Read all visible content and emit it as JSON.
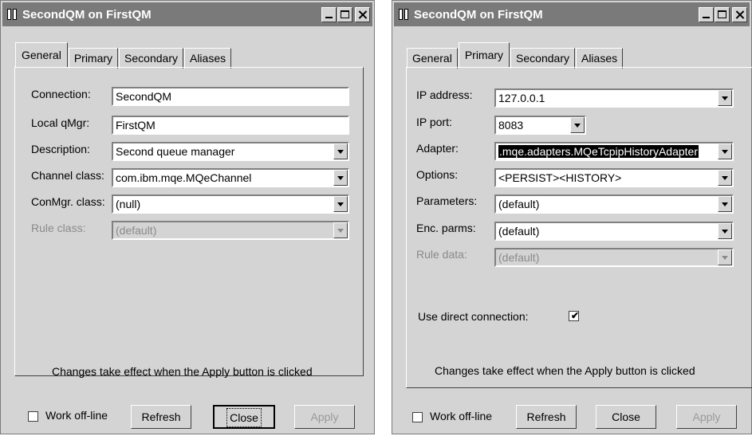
{
  "window_title": "SecondQM on FirstQM",
  "tabs": [
    "General",
    "Primary",
    "Secondary",
    "Aliases"
  ],
  "general": {
    "connection": {
      "label": "Connection:",
      "value": "SecondQM"
    },
    "local_qmgr": {
      "label": "Local qMgr:",
      "value": "FirstQM"
    },
    "description": {
      "label": "Description:",
      "value": "Second queue manager"
    },
    "channel_class": {
      "label": "Channel class:",
      "value": "com.ibm.mqe.MQeChannel"
    },
    "conmgr_class": {
      "label": "ConMgr. class:",
      "value": "(null)"
    },
    "rule_class": {
      "label": "Rule class:",
      "value": "(default)"
    }
  },
  "primary": {
    "ip_address": {
      "label": "IP address:",
      "value": "127.0.0.1"
    },
    "ip_port": {
      "label": "IP port:",
      "value": "8083"
    },
    "adapter": {
      "label": "Adapter:",
      "value": ".mqe.adapters.MQeTcpipHistoryAdapter"
    },
    "options": {
      "label": "Options:",
      "value": "<PERSIST><HISTORY>"
    },
    "parameters": {
      "label": "Parameters:",
      "value": "(default)"
    },
    "enc_parms": {
      "label": "Enc. parms:",
      "value": "(default)"
    },
    "rule_data": {
      "label": "Rule data:",
      "value": "(default)"
    },
    "direct_connection": {
      "label": "Use direct connection:",
      "checked": true
    }
  },
  "note": "Changes take effect when the Apply button is clicked",
  "footer": {
    "work_offline": "Work off-line",
    "refresh": "Refresh",
    "close": "Close",
    "apply": "Apply"
  }
}
